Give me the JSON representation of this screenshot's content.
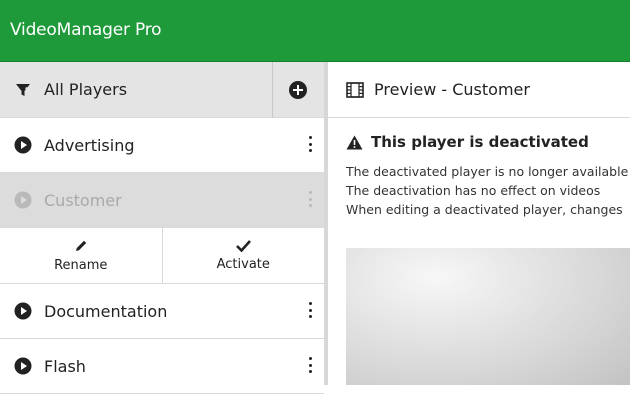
{
  "app": {
    "title": "VideoManager Pro",
    "accent": "#1f9a3b"
  },
  "sidebar": {
    "header": {
      "label": "All Players",
      "icon": "filter-icon",
      "add_icon": "plus-circle-icon"
    },
    "items": [
      {
        "label": "Advertising",
        "state": "active"
      },
      {
        "label": "Customer",
        "state": "deactivated"
      },
      {
        "label": "Documentation",
        "state": "active"
      },
      {
        "label": "Flash",
        "state": "active"
      }
    ],
    "actions": {
      "rename": "Rename",
      "activate": "Activate"
    }
  },
  "content": {
    "header": {
      "label": "Preview - Customer",
      "icon": "film-icon"
    },
    "warning": {
      "title": "This player is deactivated",
      "icon": "warning-icon"
    },
    "lines": [
      "The deactivated player is no longer available",
      "The deactivation has no effect on videos",
      "When editing a deactivated player, changes"
    ]
  }
}
